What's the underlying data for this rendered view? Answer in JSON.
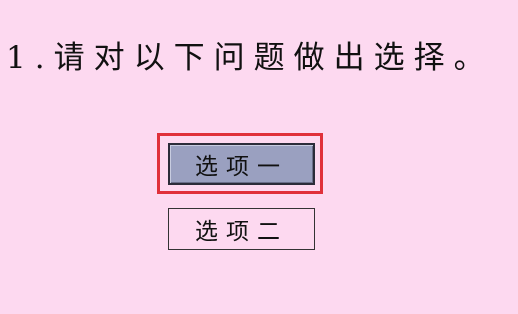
{
  "question": {
    "text": "1.请对以下问题做出选择。"
  },
  "options": [
    {
      "label": "选项一",
      "selected": true
    },
    {
      "label": "选项二",
      "selected": false
    }
  ],
  "colors": {
    "background": "#fdd9f0",
    "selected_fill": "#9aa0c0",
    "focus_ring": "#e0303a"
  }
}
